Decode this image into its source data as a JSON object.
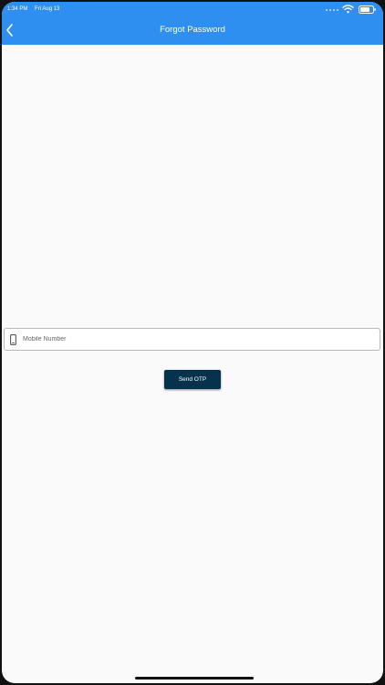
{
  "status_bar": {
    "time": "1:34 PM",
    "date": "Fri Aug 13"
  },
  "header": {
    "title": "Forgot Password",
    "background_color": "#2f8ff0",
    "back_icon": "chevron-left-icon"
  },
  "form": {
    "mobile_placeholder": "Mobile Number",
    "mobile_value": "",
    "mobile_icon": "phone-icon",
    "send_otp_label": "Send OTP",
    "button_color": "#07324e"
  }
}
